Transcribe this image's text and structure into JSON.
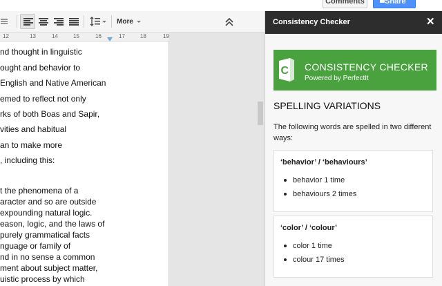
{
  "header": {
    "comments_label": "Comments",
    "share_label": "Share"
  },
  "toolbar": {
    "more_label": "More",
    "icons": [
      "comment-icon",
      "align-left-icon",
      "align-center-icon",
      "align-right-icon",
      "align-justify-icon",
      "line-spacing-icon",
      "collapse-icon"
    ]
  },
  "ruler": {
    "ticks": [
      "12",
      "13",
      "14",
      "15",
      "16",
      "17",
      "18",
      "19"
    ]
  },
  "document": {
    "lines": [
      "nd thought in linguistic",
      "ought and behavior to",
      "English and Native American",
      "emed to reflect not only",
      "rks of both Boas and Sapir,",
      "vities and habitual",
      "an to make more",
      ", including this:",
      "t the phenomena of a",
      "aracter and so are outside",
      "expounding natural logic.",
      "eason, logic, and the laws of",
      "purely grammatical facts",
      "nguage or family of",
      "nd in no sense a common",
      "ment about subject matter,",
      "uistic process by which"
    ]
  },
  "sidebar": {
    "title": "Consistency Checker",
    "close_icon": "close-icon",
    "logo": {
      "title": "CONSISTENCY CHECKER",
      "subtitle": "Powered by PerfectIt",
      "color": "#4aa23f"
    },
    "section_title": "SPELLING VARIATIONS",
    "intro": "The following words are spelled in two different ways:",
    "cards": [
      {
        "title": "‘behavior’ / ‘behaviours’",
        "items": [
          "behavior 1 time",
          "behaviours 2 times"
        ]
      },
      {
        "title": "‘color’ / ‘colour’",
        "items": [
          "color 1 time",
          "colour 17 times"
        ]
      }
    ]
  },
  "colors": {
    "header_bg": "#2d2d2d",
    "share_blue": "#4d90fe"
  }
}
